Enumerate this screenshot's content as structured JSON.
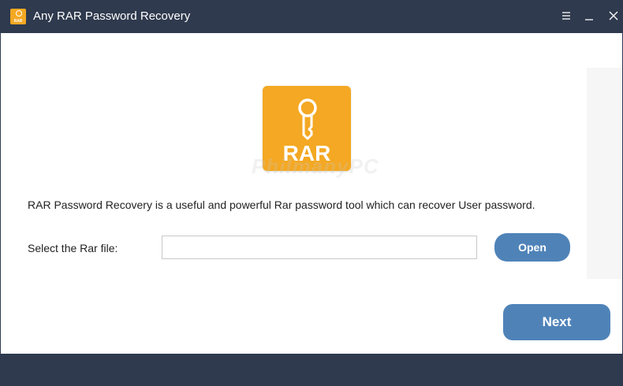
{
  "window": {
    "title": "Any RAR Password Recovery",
    "app_icon_text": "RAR",
    "controls": {
      "menu": "menu-icon",
      "minimize": "minimize-icon",
      "close": "close-icon"
    }
  },
  "logo": {
    "text": "RAR",
    "icon": "key-icon",
    "color": "#f4a823"
  },
  "watermark": "PhilmanyPC",
  "description": "RAR Password Recovery is a useful and powerful Rar password tool which can recover User password.",
  "file_select": {
    "label": "Select the Rar file:",
    "value": "",
    "placeholder": "",
    "open_label": "Open"
  },
  "next_label": "Next",
  "colors": {
    "titlebar": "#2f3a4e",
    "button": "#4f83b8",
    "accent": "#f4a823"
  }
}
